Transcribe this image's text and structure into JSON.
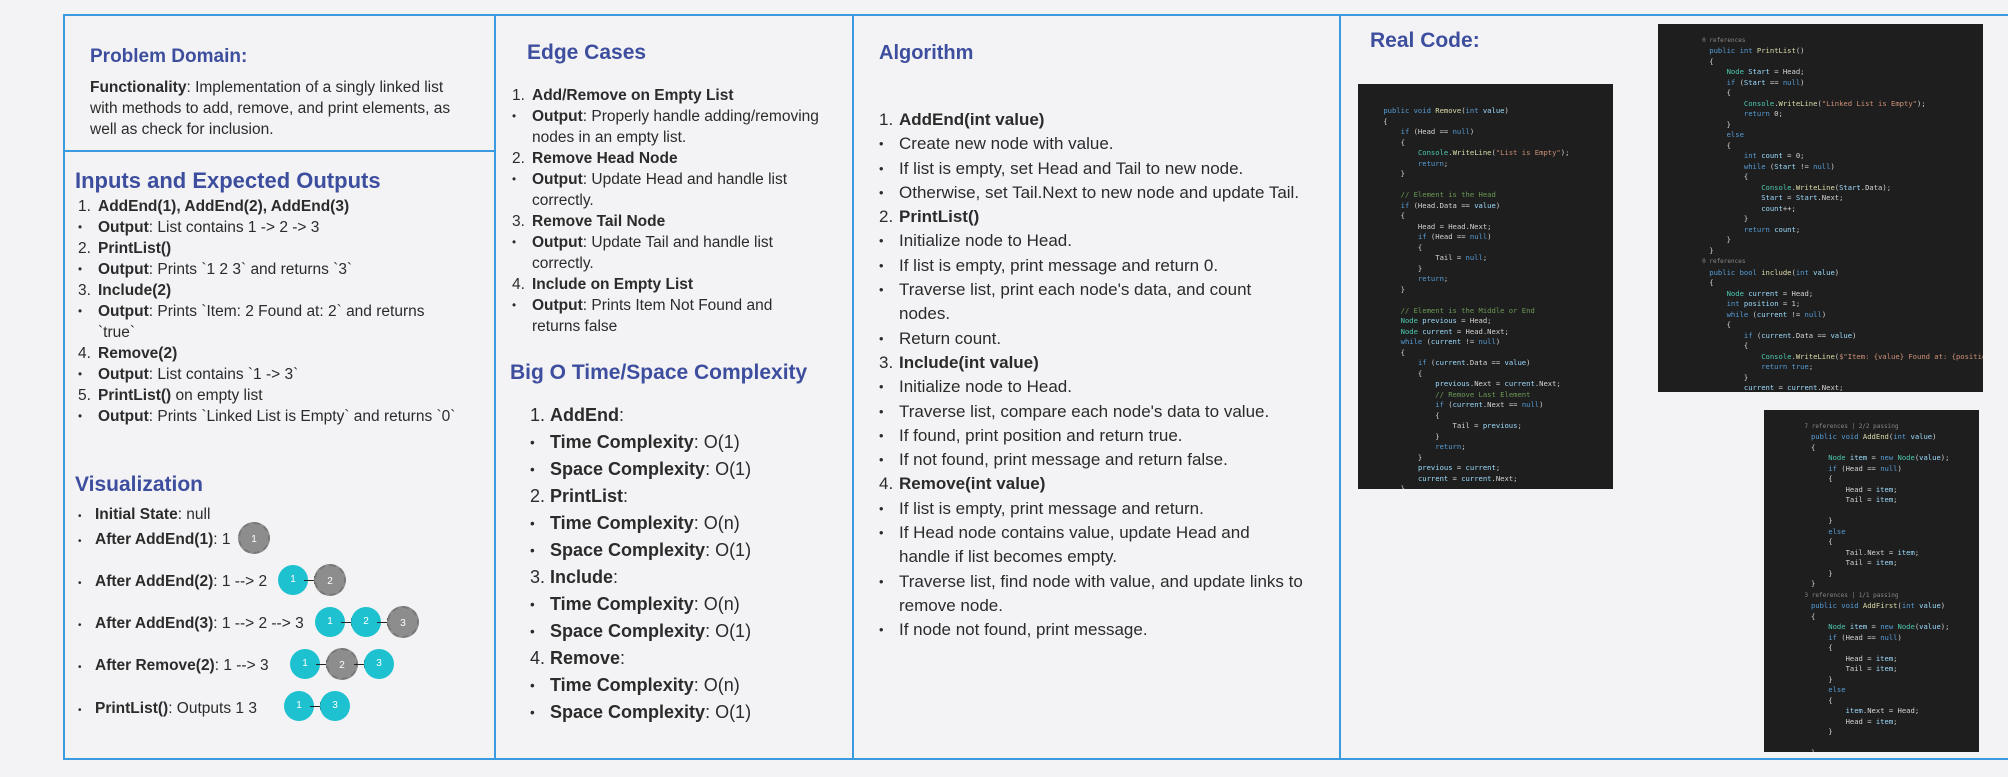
{
  "problem": {
    "title": "Problem Domain:",
    "func_label": "Functionality",
    "func_text": ": Implementation of a singly linked list with methods to add, remove, and print elements, as well as check for inclusion."
  },
  "io": {
    "title": "Inputs and Expected Outputs",
    "items": [
      {
        "marker": "1.",
        "bold": "AddEnd(1), AddEnd(2), AddEnd(3)",
        "rest": ""
      },
      {
        "marker": "•",
        "bold": "Output",
        "rest": ": List contains 1 -> 2 -> 3"
      },
      {
        "marker": "2.",
        "bold": "PrintList()",
        "rest": ""
      },
      {
        "marker": "•",
        "bold": "Output",
        "rest": ": Prints `1 2 3` and returns `3`"
      },
      {
        "marker": "3.",
        "bold": "Include(2)",
        "rest": ""
      },
      {
        "marker": "•",
        "bold": "Output",
        "rest": ": Prints `Item: 2 Found at: 2` and returns `true`"
      },
      {
        "marker": "4.",
        "bold": "Remove(2)",
        "rest": ""
      },
      {
        "marker": "•",
        "bold": "Output",
        "rest": ": List contains `1 -> 3`"
      },
      {
        "marker": "5.",
        "bold": "PrintList()",
        "rest": " on empty list"
      },
      {
        "marker": "•",
        "bold": "Output",
        "rest": ": Prints `Linked List is Empty` and returns `0`"
      }
    ]
  },
  "viz": {
    "title": "Visualization",
    "initial_label": "Initial State",
    "initial_value": ": null",
    "rows": [
      {
        "label": "After AddEnd(1)",
        "text": ": 1",
        "nodes": [
          "1"
        ],
        "gray_last": true
      },
      {
        "label": "After AddEnd(2)",
        "text": ": 1 --> 2",
        "nodes": [
          "1",
          "2"
        ],
        "gray_last": true
      },
      {
        "label": "After AddEnd(3)",
        "text": ": 1 --> 2 --> 3",
        "nodes": [
          "1",
          "2",
          "3"
        ],
        "gray_last": true
      },
      {
        "label": "After Remove(2)",
        "text": ": 1 --> 3",
        "nodes": [
          "1",
          "2",
          "3"
        ],
        "gray_middle": true
      },
      {
        "label": "PrintList()",
        "text": ": Outputs 1 3",
        "nodes": [
          "1",
          "3"
        ],
        "gray_last": false
      }
    ]
  },
  "edge": {
    "title": "Edge Cases",
    "items": [
      {
        "marker": "1.",
        "bold": "Add/Remove on Empty List",
        "rest": ""
      },
      {
        "marker": "•",
        "bold": "Output",
        "rest": ": Properly handle adding/removing nodes in an empty list."
      },
      {
        "marker": "2.",
        "bold": "Remove Head Node",
        "rest": ""
      },
      {
        "marker": "•",
        "bold": "Output",
        "rest": ": Update Head and handle list correctly."
      },
      {
        "marker": "3.",
        "bold": "Remove Tail Node",
        "rest": ""
      },
      {
        "marker": "•",
        "bold": "Output",
        "rest": ": Update Tail and handle list correctly."
      },
      {
        "marker": "4.",
        "bold": "Include on Empty List",
        "rest": ""
      },
      {
        "marker": "•",
        "bold": "Output",
        "rest": ": Prints Item Not Found and returns false"
      }
    ]
  },
  "bigo": {
    "title": "Big O Time/Space Complexity",
    "items": [
      {
        "marker": "1.",
        "bold": "AddEnd",
        "rest": ":"
      },
      {
        "marker": "•",
        "bold": "Time Complexity",
        "rest": ": O(1)"
      },
      {
        "marker": "•",
        "bold": "Space Complexity",
        "rest": ": O(1)"
      },
      {
        "marker": "2.",
        "bold": "PrintList",
        "rest": ":"
      },
      {
        "marker": "•",
        "bold": "Time Complexity",
        "rest": ": O(n)"
      },
      {
        "marker": "•",
        "bold": "Space Complexity",
        "rest": ": O(1)"
      },
      {
        "marker": "3.",
        "bold": "Include",
        "rest": ":"
      },
      {
        "marker": "•",
        "bold": "Time Complexity",
        "rest": ": O(n)"
      },
      {
        "marker": "•",
        "bold": "Space Complexity",
        "rest": ": O(1)"
      },
      {
        "marker": "4.",
        "bold": "Remove",
        "rest": ":"
      },
      {
        "marker": "•",
        "bold": "Time Complexity",
        "rest": ": O(n)"
      },
      {
        "marker": "•",
        "bold": "Space Complexity",
        "rest": ": O(1)"
      }
    ]
  },
  "algo": {
    "title": "Algorithm",
    "items": [
      {
        "marker": "1.",
        "bold": "AddEnd(int value)",
        "rest": ""
      },
      {
        "marker": "•",
        "bold": "",
        "rest": "Create new node with value."
      },
      {
        "marker": "•",
        "bold": "",
        "rest": "If list is empty, set Head and Tail to new node."
      },
      {
        "marker": "•",
        "bold": "",
        "rest": "Otherwise, set Tail.Next to new node and update Tail."
      },
      {
        "marker": "2.",
        "bold": "PrintList()",
        "rest": ""
      },
      {
        "marker": "•",
        "bold": "",
        "rest": "Initialize node to Head."
      },
      {
        "marker": "•",
        "bold": "",
        "rest": "If list is empty, print message and return 0."
      },
      {
        "marker": "•",
        "bold": "",
        "rest": "Traverse list, print each node's data, and count nodes."
      },
      {
        "marker": "•",
        "bold": "",
        "rest": "Return count."
      },
      {
        "marker": "3.",
        "bold": "Include(int value)",
        "rest": ""
      },
      {
        "marker": "•",
        "bold": "",
        "rest": "Initialize node to Head."
      },
      {
        "marker": "•",
        "bold": "",
        "rest": "Traverse list, compare each node's data to value."
      },
      {
        "marker": "•",
        "bold": "",
        "rest": "If found, print position and return true."
      },
      {
        "marker": "•",
        "bold": "",
        "rest": "If not found, print message and return false."
      },
      {
        "marker": "4.",
        "bold": "Remove(int value)",
        "rest": ""
      },
      {
        "marker": "•",
        "bold": "",
        "rest": "If list is empty, print message and return."
      },
      {
        "marker": "•",
        "bold": "",
        "rest": "If Head node contains value, update Head and handle if list becomes empty."
      },
      {
        "marker": "•",
        "bold": "",
        "rest": "Traverse list, find node with value, and update links to remove node."
      },
      {
        "marker": "•",
        "bold": "",
        "rest": "If node not found, print message."
      }
    ]
  },
  "real": {
    "title": "Real Code:"
  }
}
